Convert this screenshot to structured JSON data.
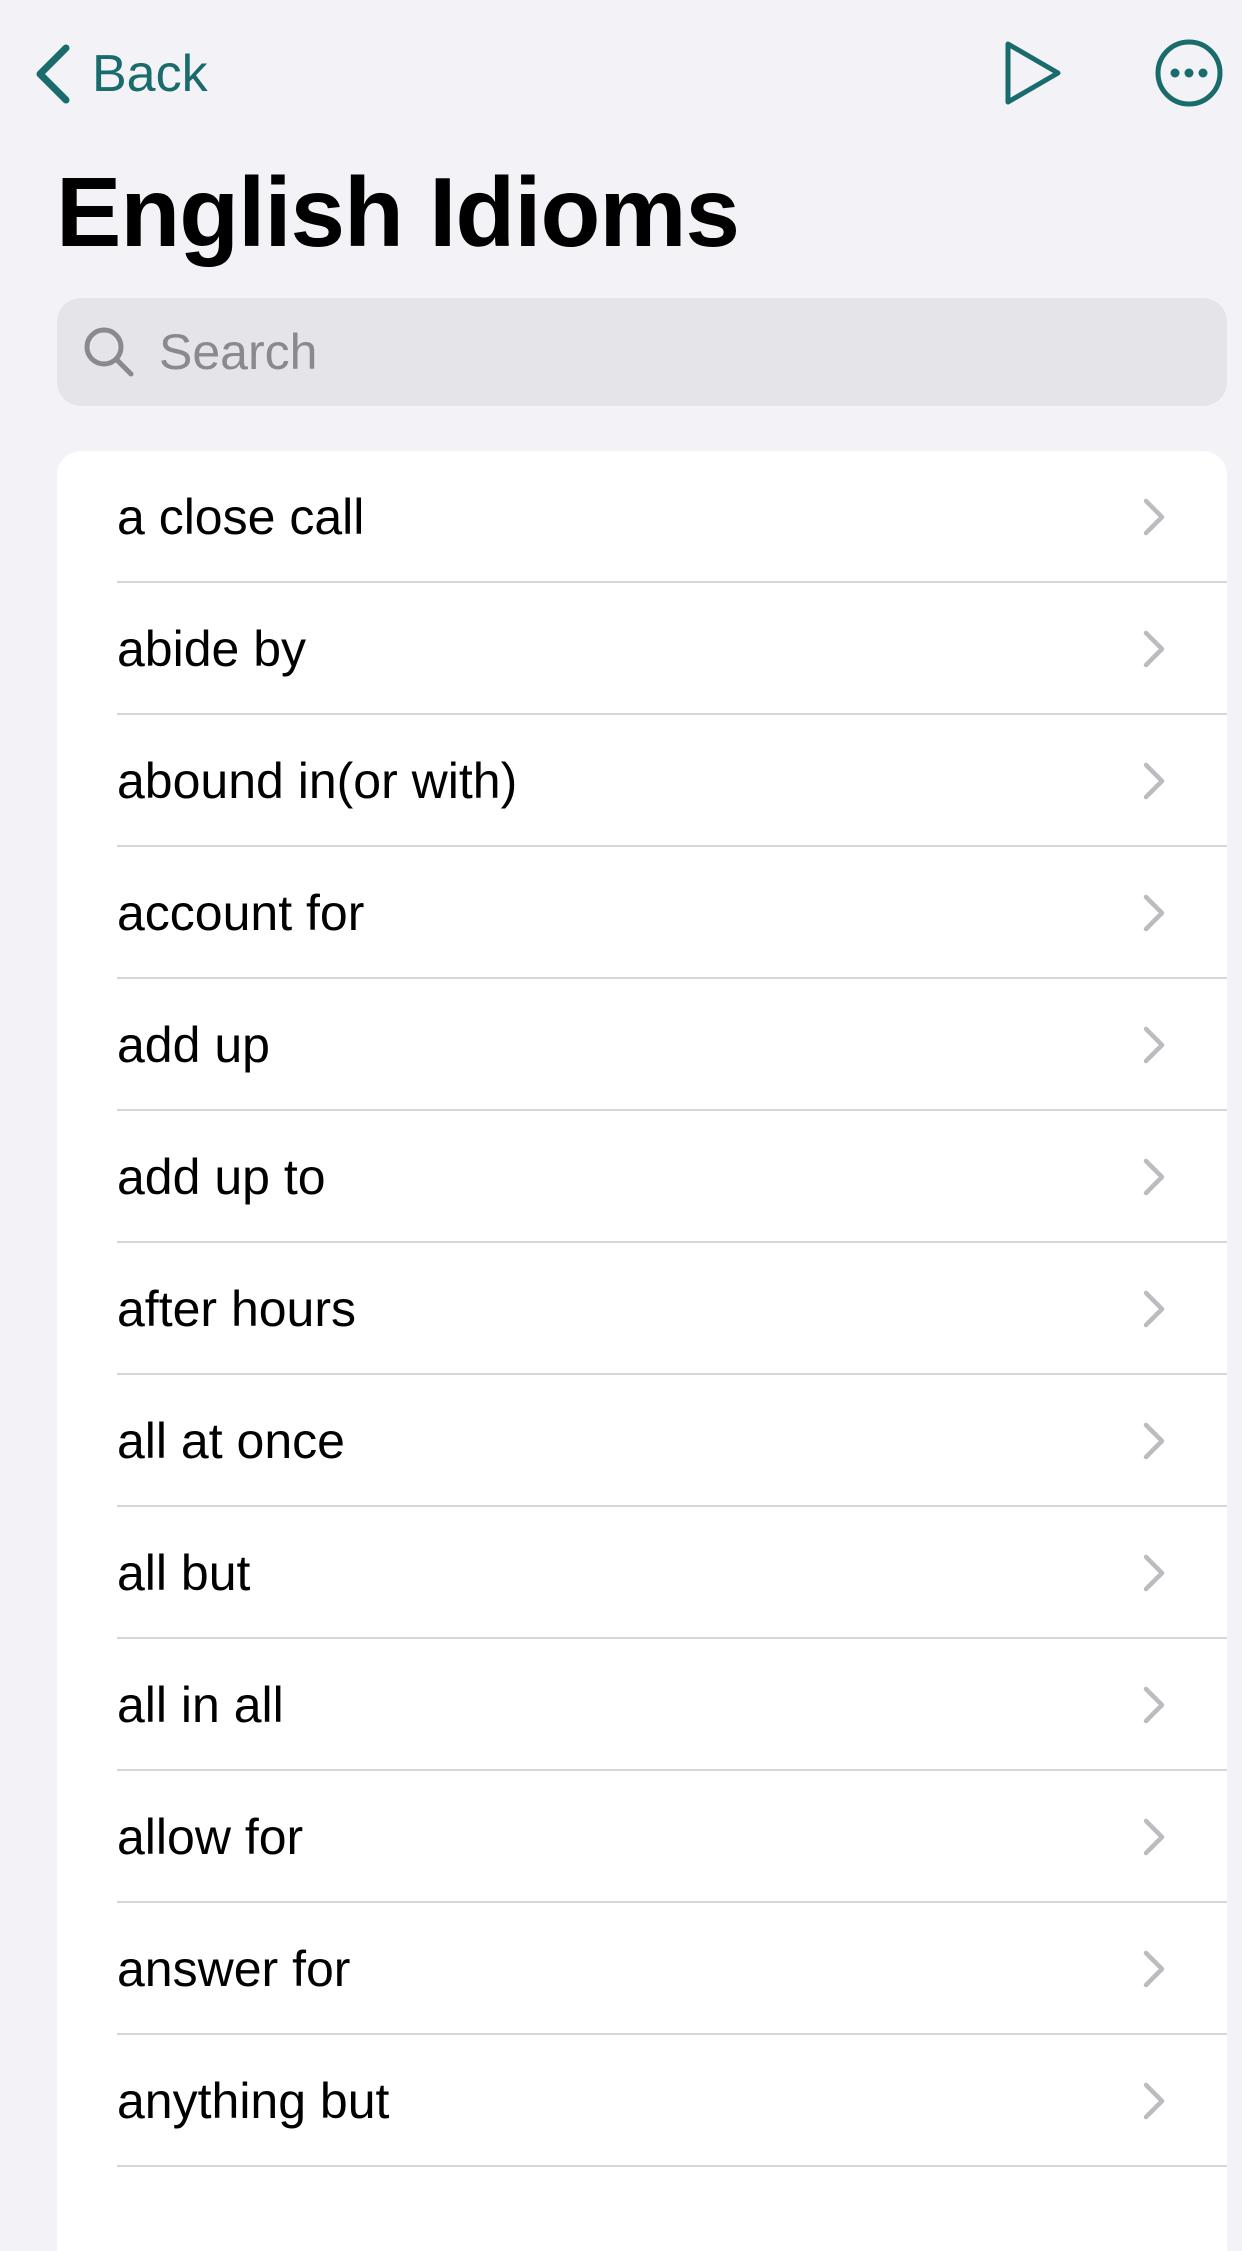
{
  "nav": {
    "back_label": "Back",
    "back_icon": "chevron-left-icon",
    "play_icon": "play-icon",
    "more_icon": "ellipsis-circle-icon",
    "accent_color": "#1a6b6b"
  },
  "page": {
    "title": "English Idioms"
  },
  "search": {
    "placeholder": "Search",
    "value": ""
  },
  "list": {
    "items": [
      {
        "label": "a close call"
      },
      {
        "label": "abide by"
      },
      {
        "label": "abound in(or with)"
      },
      {
        "label": "account for"
      },
      {
        "label": "add up"
      },
      {
        "label": "add up to"
      },
      {
        "label": "after hours"
      },
      {
        "label": "all at once"
      },
      {
        "label": "all but"
      },
      {
        "label": "all in all"
      },
      {
        "label": "allow for"
      },
      {
        "label": "answer for"
      },
      {
        "label": "anything but"
      }
    ]
  }
}
